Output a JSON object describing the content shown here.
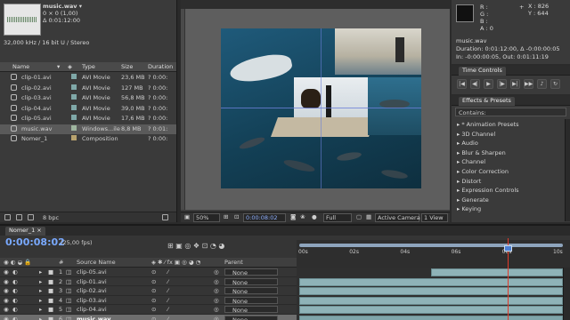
{
  "project": {
    "selected_name": "music.wav ▾",
    "dims": "0 × 0 (1,00)",
    "duration": "Δ 0:01:12:00",
    "audio": "32,000 kHz / 16 bit U / Stereo",
    "columns": [
      "Name",
      "Type",
      "Size",
      "Duration"
    ],
    "items": [
      {
        "name": "clip-01.avi",
        "type": "AVI Movie",
        "size": "23,6 MB",
        "duration": "? 0:00:",
        "color": "#7fa8a8"
      },
      {
        "name": "clip-02.avi",
        "type": "AVI Movie",
        "size": "127 MB",
        "duration": "? 0:00:",
        "color": "#7fa8a8"
      },
      {
        "name": "clip-03.avi",
        "type": "AVI Movie",
        "size": "56,8 MB",
        "duration": "? 0:00:",
        "color": "#7fa8a8"
      },
      {
        "name": "clip-04.avi",
        "type": "AVI Movie",
        "size": "39,0 MB",
        "duration": "? 0:00:",
        "color": "#7fa8a8"
      },
      {
        "name": "clip-05.avi",
        "type": "AVI Movie",
        "size": "17,6 MB",
        "duration": "? 0:00:",
        "color": "#7fa8a8"
      },
      {
        "name": "music.wav",
        "type": "Windows...ile",
        "size": "8,8 MB",
        "duration": "? 0:01:",
        "color": "#9fb59f",
        "selected": true
      },
      {
        "name": "Nomer_1",
        "type": "Composition",
        "size": "",
        "duration": "? 0:00:",
        "color": "#b7a26e"
      }
    ],
    "bpc": "8 bpc"
  },
  "viewer": {
    "zoom": "50%",
    "timecode": "0:00:08:02",
    "resolution": "Full",
    "camera": "Active Camera",
    "views": "1 View"
  },
  "info": {
    "r": "R :",
    "g": "G :",
    "b": "B :",
    "a": "A : 0",
    "x": "X : 826",
    "y": "Y : 644",
    "file": "music.wav",
    "duration": "Duration: 0:01:12:00, Δ -0:00:00:05",
    "inout": "In: -0:00:00:05, Out: 0:01:11:19"
  },
  "time_controls": {
    "tab": "Time Controls",
    "buttons": [
      "|◀",
      "◀|",
      "▶",
      "|▶",
      "▶|",
      "▶▶",
      "♪",
      "↻"
    ]
  },
  "effects": {
    "tab": "Effects & Presets",
    "search_label": "Contains:",
    "items": [
      "▸ * Animation Presets",
      "▸ 3D Channel",
      "▸ Audio",
      "▸ Blur & Sharpen",
      "▸ Channel",
      "▸ Color Correction",
      "▸ Distort",
      "▸ Expression Controls",
      "▸ Generate",
      "▸ Keying"
    ]
  },
  "timeline": {
    "tab": "Nomer_1 ×",
    "time": "0:00:08:02",
    "fps": "(25,00 fps)",
    "columns": {
      "num": "#",
      "source": "Source Name",
      "parent": "Parent"
    },
    "ruler": [
      "00s",
      "02s",
      "04s",
      "06s",
      "08s",
      "10s"
    ],
    "layers": [
      {
        "num": "1",
        "name": "clip-05.avi",
        "parent": "None",
        "start": 0.5,
        "end": 1.0
      },
      {
        "num": "2",
        "name": "clip-01.avi",
        "parent": "None",
        "start": 0.0,
        "end": 1.0
      },
      {
        "num": "3",
        "name": "clip-02.avi",
        "parent": "None",
        "start": 0.0,
        "end": 1.0
      },
      {
        "num": "4",
        "name": "clip-03.avi",
        "parent": "None",
        "start": 0.0,
        "end": 1.0
      },
      {
        "num": "5",
        "name": "clip-04.avi",
        "parent": "None",
        "start": 0.0,
        "end": 1.0
      },
      {
        "num": "6",
        "name": "music.wav",
        "parent": "None",
        "start": 0.0,
        "end": 1.0,
        "selected": true
      }
    ],
    "current_time_fraction": 0.79
  }
}
